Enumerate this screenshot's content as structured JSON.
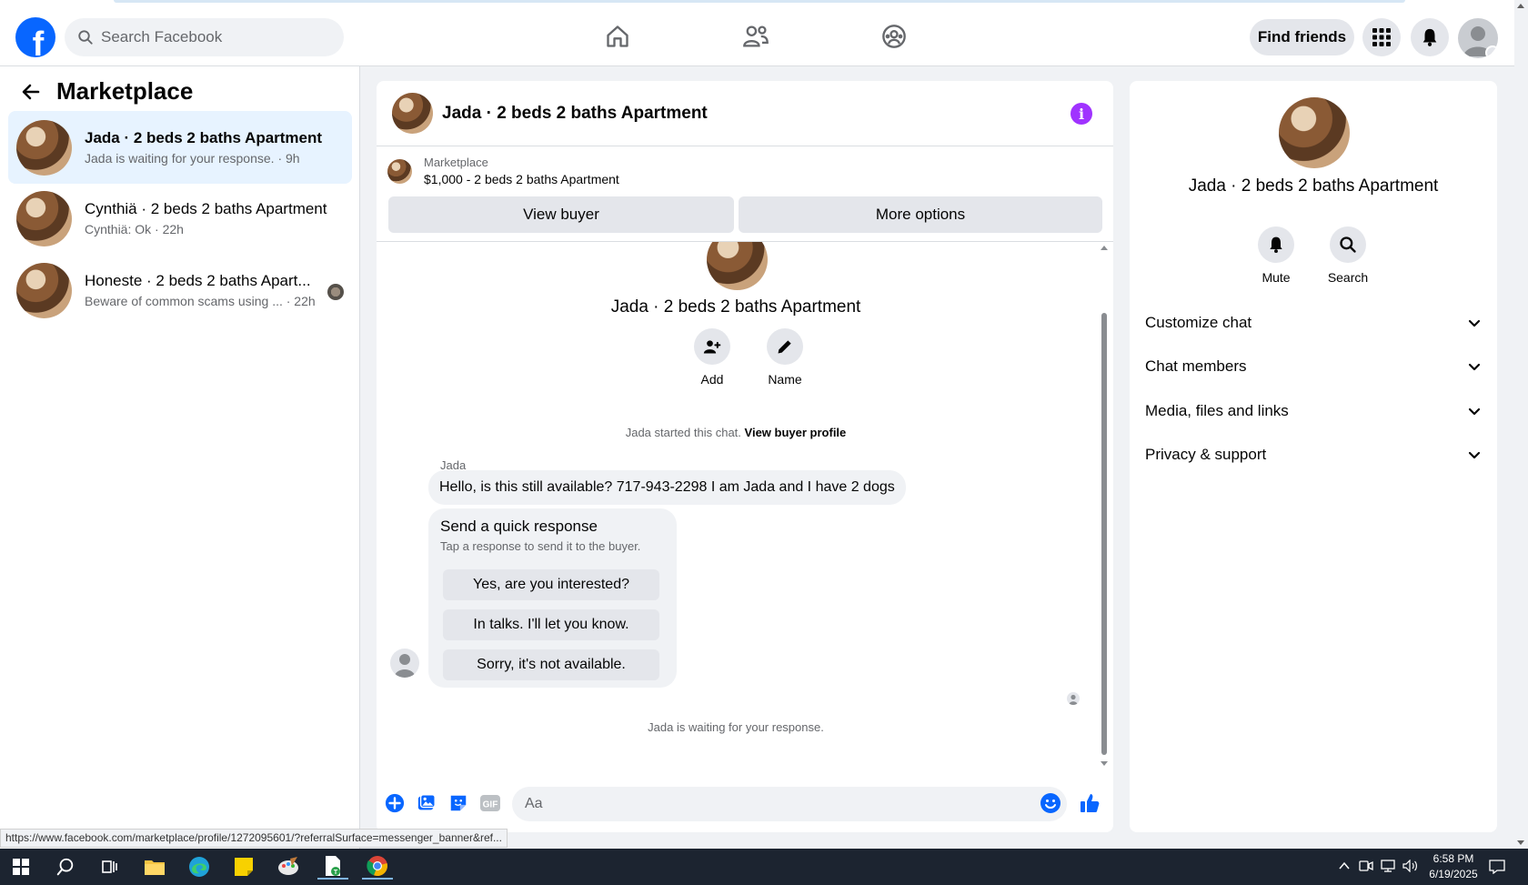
{
  "header": {
    "search_placeholder": "Search Facebook",
    "find_friends": "Find friends",
    "colors": {
      "brand": "#0866ff",
      "accent_purple": "#a033ff"
    }
  },
  "sidebar": {
    "title": "Marketplace",
    "conversations": [
      {
        "title": "Jada · 2 beds 2 baths Apartment",
        "subtitle": "Jada is waiting for your response. · 9h",
        "active": true
      },
      {
        "title": "Cynthiä · 2 beds 2 baths Apartment",
        "subtitle": "Cynthiä: Ok · 22h",
        "active": false
      },
      {
        "title": "Honeste · 2 beds 2 baths Apart...",
        "subtitle": "Beware of common scams using ...  · 22h",
        "active": false
      }
    ]
  },
  "chat": {
    "title": "Jada · 2 beds 2 baths Apartment",
    "listing_source": "Marketplace",
    "listing_price": "$1,000 - 2 beds 2 baths Apartment",
    "view_buyer": "View buyer",
    "more_options": "More options",
    "center_title": "Jada · 2 beds 2 baths Apartment",
    "actions": {
      "add": "Add",
      "name": "Name"
    },
    "started_text": "Jada started this chat.",
    "view_buyer_profile": "View buyer profile",
    "sender": "Jada",
    "message": "Hello, is this still available? 717-943-2298 I am Jada and I have 2 dogs",
    "quick": {
      "title": "Send a quick response",
      "subtitle": "Tap a response to send it to the buyer.",
      "options": [
        "Yes, are you interested?",
        "In talks. I'll let you know.",
        "Sorry, it's not available."
      ]
    },
    "waiting_text": "Jada is waiting for your response.",
    "input_placeholder": "Aa"
  },
  "info_panel": {
    "title": "Jada · 2 beds 2 baths Apartment",
    "mute": "Mute",
    "search": "Search",
    "sections": [
      "Customize chat",
      "Chat members",
      "Media, files and links",
      "Privacy & support"
    ]
  },
  "status_url": "https://www.facebook.com/marketplace/profile/1272095601/?referralSurface=messenger_banner&ref...",
  "taskbar": {
    "time": "6:58 PM",
    "date": "6/19/2025"
  }
}
